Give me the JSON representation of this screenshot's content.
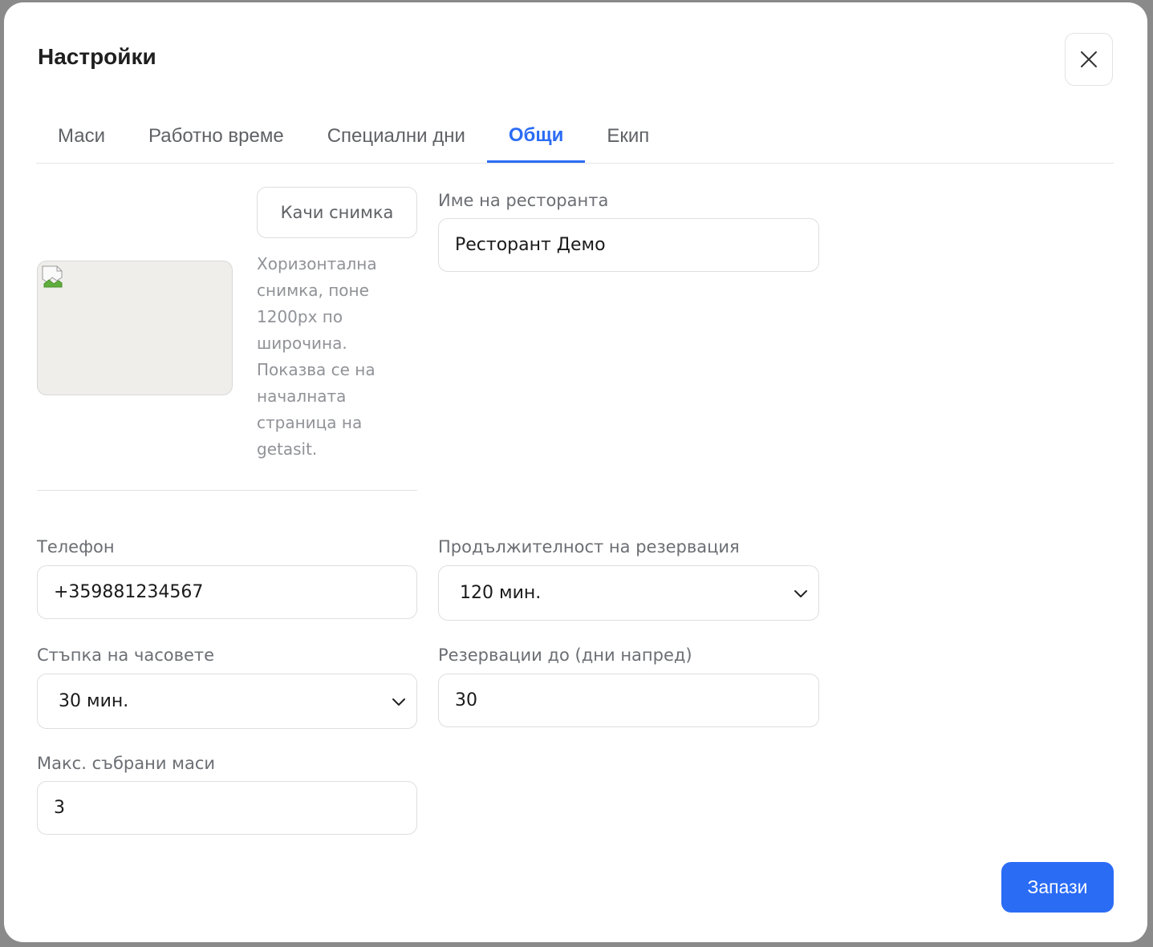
{
  "modal": {
    "title": "Настройки",
    "close_icon": "close-icon"
  },
  "tabs": [
    {
      "label": "Маси",
      "active": false
    },
    {
      "label": "Работно време",
      "active": false
    },
    {
      "label": "Специални дни",
      "active": false
    },
    {
      "label": "Общи",
      "active": true
    },
    {
      "label": "Екип",
      "active": false
    }
  ],
  "colors": {
    "accent": "#2b6cf5",
    "image_placeholder": "#efeeeb"
  },
  "photo": {
    "upload_label": "Качи снимка",
    "hint": "Хоризонтална снимка, поне 1200px по широчина. Показва се на началната страница на getasit.",
    "placeholder_icon": "broken-image-icon"
  },
  "restaurant_name": {
    "label": "Име на ресторанта",
    "value": "Ресторант Демо"
  },
  "phone": {
    "label": "Телефон",
    "value": "+359881234567"
  },
  "duration": {
    "label": "Продължителност на резервация",
    "value": "120 мин.",
    "icon": "chevron-down-icon"
  },
  "time_step": {
    "label": "Стъпка на часовете",
    "value": "30 мин.",
    "icon": "chevron-down-icon"
  },
  "days_ahead": {
    "label": "Резервации до (дни напред)",
    "value": "30"
  },
  "max_tables": {
    "label": "Макс. събрани маси",
    "value": "3"
  },
  "footer": {
    "save_label": "Запази"
  }
}
